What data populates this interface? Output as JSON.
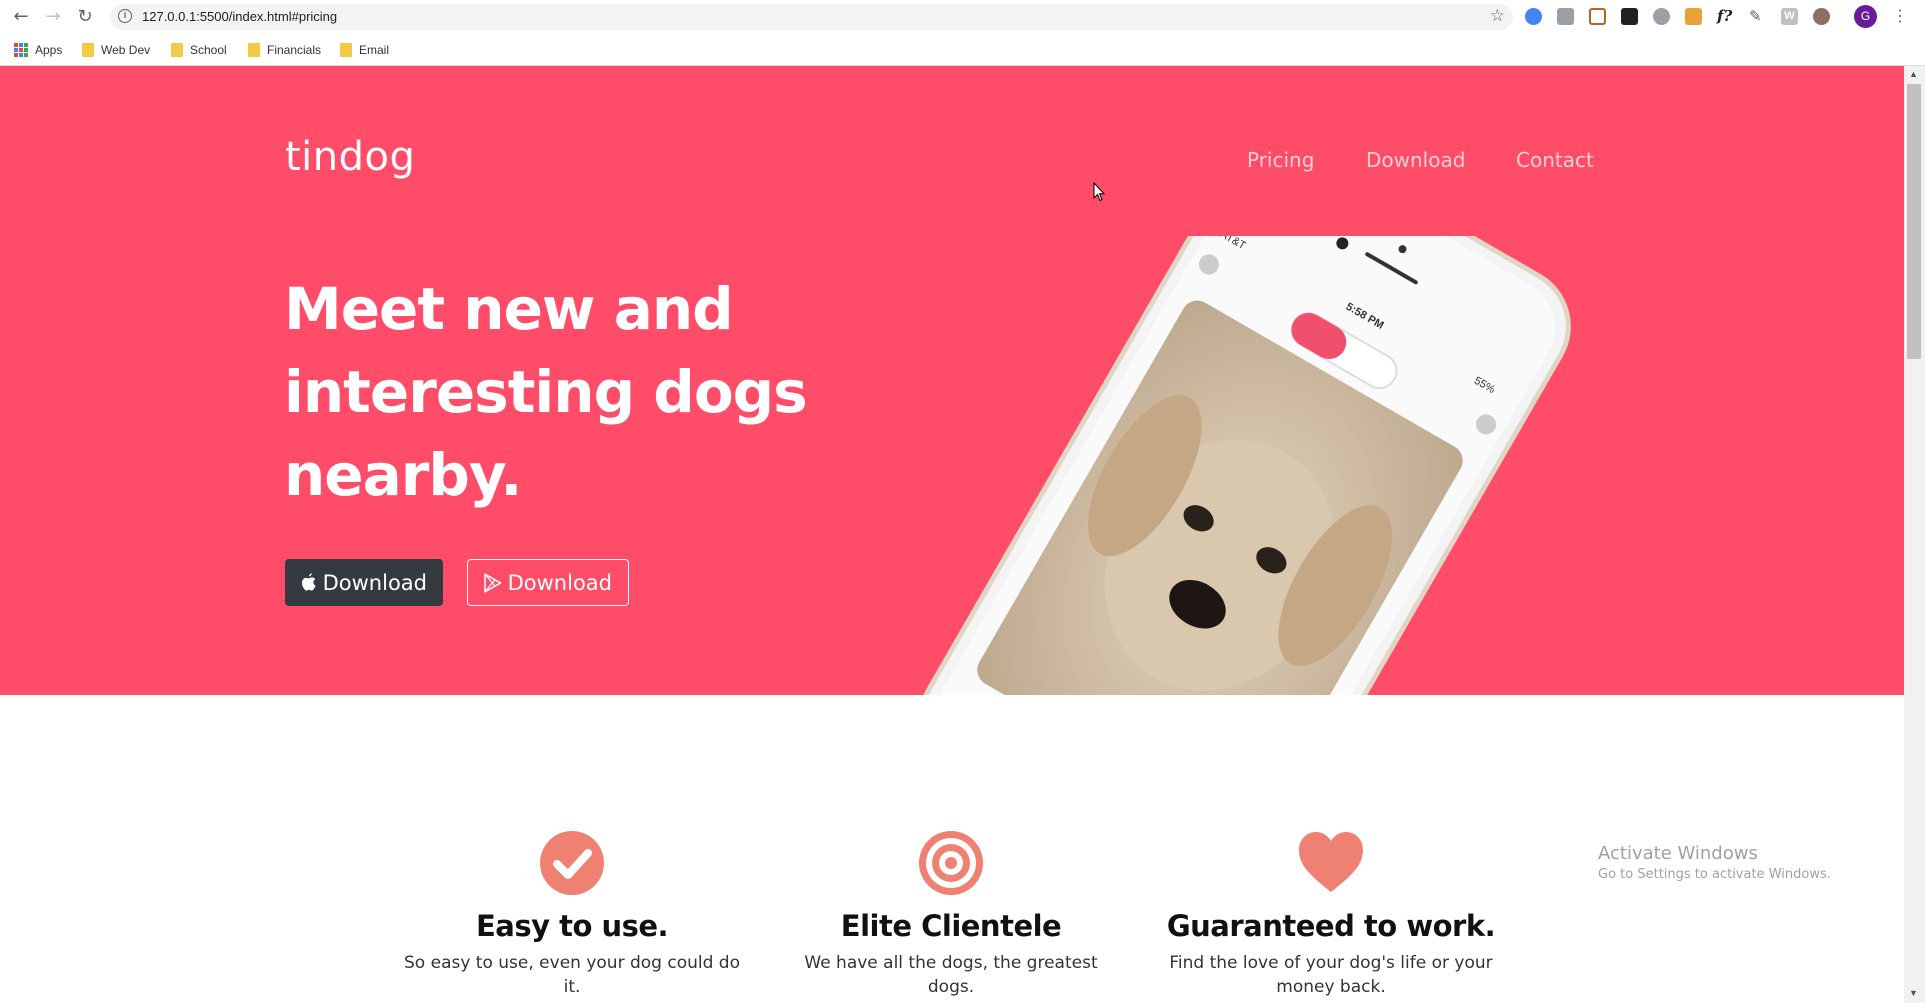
{
  "browser": {
    "url": "127.0.0.1:5500/index.html#pricing",
    "avatar_letter": "G",
    "bookmarks": [
      {
        "label": "Apps",
        "icon": "apps-grid-icon"
      },
      {
        "label": "Web Dev",
        "icon": "folder-icon"
      },
      {
        "label": "School",
        "icon": "folder-icon"
      },
      {
        "label": "Financials",
        "icon": "folder-icon"
      },
      {
        "label": "Email",
        "icon": "folder-icon"
      }
    ]
  },
  "page": {
    "brand": "tindog",
    "nav": [
      "Pricing",
      "Download",
      "Contact"
    ],
    "headline": "Meet new and interesting dogs nearby.",
    "buttons": {
      "apple_download": "Download",
      "play_download": "Download"
    },
    "phone": {
      "carrier": "AT&T",
      "time": "5:58 PM",
      "battery": "55%"
    },
    "features": [
      {
        "icon": "check-circle-icon",
        "title": "Easy to use.",
        "text": "So easy to use, even your dog could do it."
      },
      {
        "icon": "bullseye-icon",
        "title": "Elite Clientele",
        "text": "We have all the dogs, the greatest dogs."
      },
      {
        "icon": "heart-icon",
        "title": "Guaranteed to work.",
        "text": "Find the love of your dog's life or your money back."
      }
    ]
  },
  "os_watermark": {
    "line1": "Activate Windows",
    "line2": "Go to Settings to activate Windows."
  },
  "colors": {
    "hero_bg": "#ff4c68",
    "accent": "#ef8172",
    "dark_button": "#343a40"
  }
}
